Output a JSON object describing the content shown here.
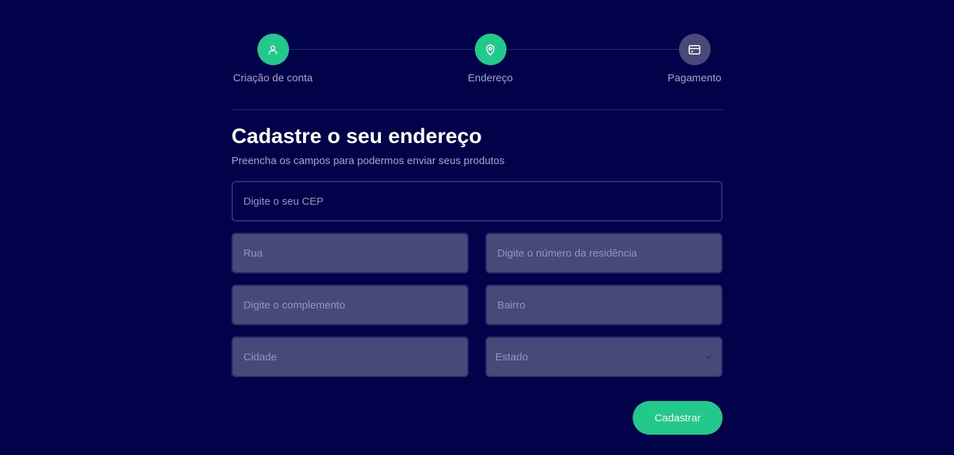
{
  "stepper": {
    "steps": [
      {
        "label": "Criação de conta",
        "icon": "user-icon",
        "status": "done"
      },
      {
        "label": "Endereço",
        "icon": "map-pin-icon",
        "status": "current"
      },
      {
        "label": "Pagamento",
        "icon": "credit-card-icon",
        "status": "pending"
      }
    ]
  },
  "header": {
    "title": "Cadastre o seu endereço",
    "subtitle": "Preencha os campos para podermos enviar seus produtos"
  },
  "form": {
    "cep_placeholder": "Digite o seu CEP",
    "rua_placeholder": "Rua",
    "numero_placeholder": "Digite o número da residência",
    "complemento_placeholder": "Digite o complemento",
    "bairro_placeholder": "Bairro",
    "cidade_placeholder": "Cidade",
    "estado_selected": "Estado",
    "submit_label": "Cadastrar"
  },
  "colors": {
    "background": "#02024a",
    "accent": "#22c98a",
    "field_dark": "#484879"
  }
}
